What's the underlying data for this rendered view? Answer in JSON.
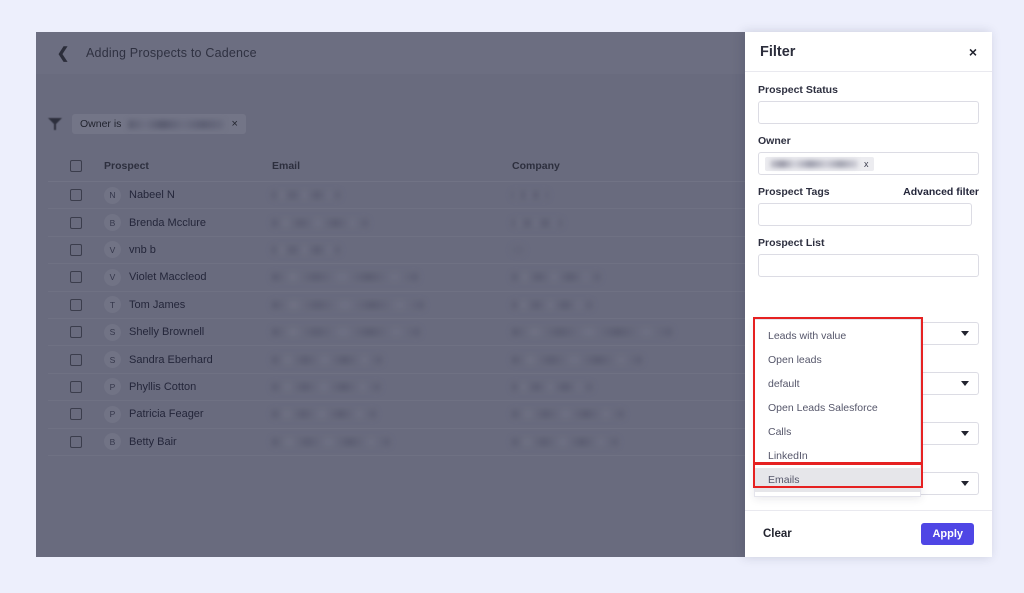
{
  "page": {
    "background_color": "#edeffc",
    "overlay_color": "#696b7e",
    "accent_color": "#4f46e5",
    "annotation_color": "#e62121"
  },
  "app": {
    "back_icon": "chevron-left-icon",
    "title": "Adding Prospects to Cadence",
    "filter_chip": {
      "icon": "funnel-icon",
      "label": "Owner is",
      "value_redacted": true,
      "remove_label": "×"
    },
    "table": {
      "columns": [
        "Prospect",
        "Email",
        "Company"
      ],
      "select_all_label": "",
      "rows": [
        {
          "initial": "N",
          "name": "Nabeel N",
          "email_redacted": true,
          "company_redacted": true,
          "email_w": 68,
          "company_w": 36
        },
        {
          "initial": "B",
          "name": "Brenda Mcclure",
          "email_redacted": true,
          "company_redacted": true,
          "email_w": 96,
          "company_w": 50
        },
        {
          "initial": "V",
          "name": "vnb b",
          "email_redacted": true,
          "company_redacted": true,
          "email_w": 68,
          "company_w": 12
        },
        {
          "initial": "V",
          "name": "Violet Maccleod",
          "email_redacted": true,
          "company_redacted": true,
          "email_w": 146,
          "company_w": 88
        },
        {
          "initial": "T",
          "name": "Tom James",
          "email_redacted": true,
          "company_redacted": true,
          "email_w": 152,
          "company_w": 80
        },
        {
          "initial": "S",
          "name": "Shelly Brownell",
          "email_redacted": true,
          "company_redacted": true,
          "email_w": 148,
          "company_w": 160
        },
        {
          "initial": "S",
          "name": "Sandra Eberhard",
          "email_redacted": true,
          "company_redacted": true,
          "email_w": 110,
          "company_w": 130
        },
        {
          "initial": "P",
          "name": "Phyllis Cotton",
          "email_redacted": true,
          "company_redacted": true,
          "email_w": 108,
          "company_w": 80
        },
        {
          "initial": "P",
          "name": "Patricia Feager",
          "email_redacted": true,
          "company_redacted": true,
          "email_w": 104,
          "company_w": 112
        },
        {
          "initial": "B",
          "name": "Betty Bair",
          "email_redacted": true,
          "company_redacted": true,
          "email_w": 118,
          "company_w": 106
        }
      ]
    }
  },
  "filter_panel": {
    "title": "Filter",
    "close_label": "×",
    "fields": {
      "prospect_status": {
        "label": "Prospect Status",
        "value": "",
        "placeholder": ""
      },
      "owner": {
        "label": "Owner",
        "token_redacted": true,
        "token_remove_label": "x"
      },
      "prospect_tags": {
        "label": "Prospect Tags",
        "advanced_filter_label": "Advanced filter",
        "value": "",
        "placeholder": ""
      },
      "prospect_list": {
        "label": "Prospect List",
        "value": "",
        "placeholder": ""
      }
    },
    "selects": [
      {
        "value": "",
        "chevron": "chevron-down-icon"
      },
      {
        "value": "",
        "chevron": "chevron-down-icon"
      },
      {
        "value": "",
        "chevron": "chevron-down-icon"
      },
      {
        "value": "",
        "chevron": "chevron-down-icon"
      }
    ],
    "dropdown": {
      "open": true,
      "options": [
        {
          "label": "Leads with value",
          "hovered": false
        },
        {
          "label": "Open leads",
          "hovered": false
        },
        {
          "label": "default",
          "hovered": false
        },
        {
          "label": "Open Leads Salesforce",
          "hovered": false
        },
        {
          "label": "Calls",
          "hovered": false
        },
        {
          "label": "LinkedIn",
          "hovered": false
        },
        {
          "label": "Emails",
          "hovered": true
        }
      ]
    },
    "footer": {
      "clear_label": "Clear",
      "apply_label": "Apply"
    }
  }
}
